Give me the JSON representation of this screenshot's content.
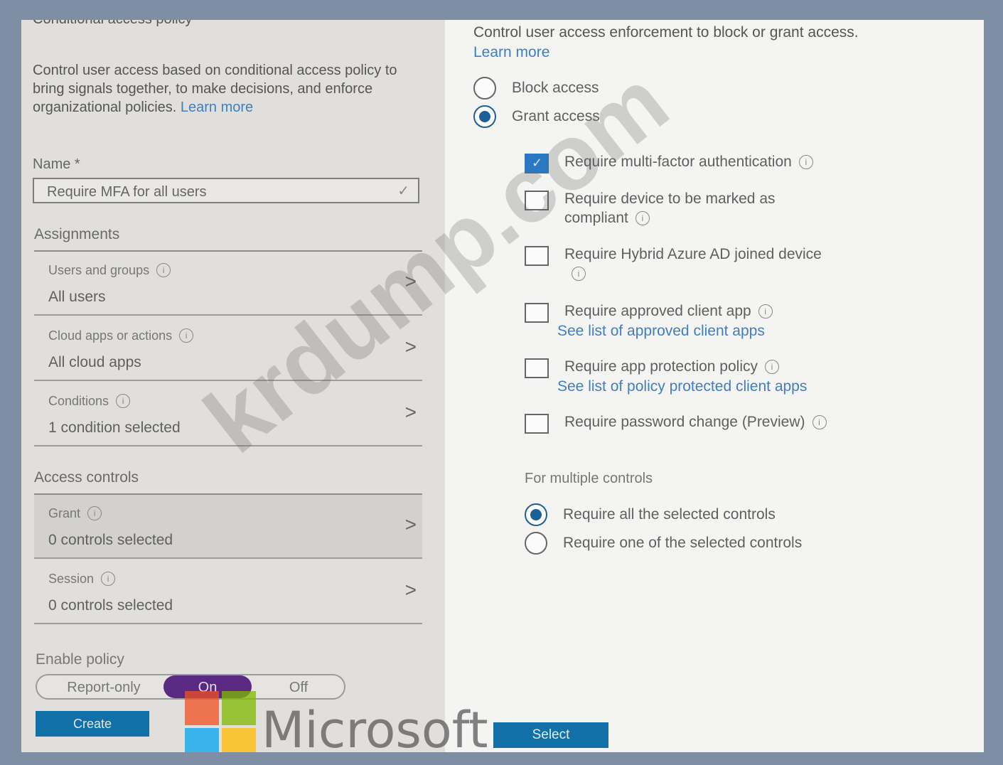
{
  "left": {
    "header_partial": "Conditional access policy",
    "intro": "Control user access based on conditional access policy to bring signals together, to make decisions, and enforce organizational policies.",
    "intro_link": "Learn more",
    "name_label": "Name *",
    "name_value": "Require MFA for all users",
    "assignments_title": "Assignments",
    "assignments": [
      {
        "label": "Users and groups",
        "value": "All users"
      },
      {
        "label": "Cloud apps or actions",
        "value": "All cloud apps"
      },
      {
        "label": "Conditions",
        "value": "1 condition selected"
      }
    ],
    "access_controls_title": "Access controls",
    "access_controls": [
      {
        "label": "Grant",
        "value": "0 controls selected"
      },
      {
        "label": "Session",
        "value": "0 controls selected"
      }
    ],
    "enable_label": "Enable policy",
    "enable_options": [
      "Report-only",
      "On",
      "Off"
    ],
    "enable_selected": "On",
    "create_label": "Create"
  },
  "right": {
    "intro": "Control user access enforcement to block or grant access.",
    "intro_link": "Learn more",
    "access_options": [
      {
        "label": "Block access",
        "selected": false
      },
      {
        "label": "Grant access",
        "selected": true
      }
    ],
    "grant_controls": [
      {
        "label": "Require multi-factor authentication",
        "checked": true,
        "link": ""
      },
      {
        "label": "Require device to be marked as compliant",
        "checked": false,
        "link": ""
      },
      {
        "label": "Require Hybrid Azure AD joined device",
        "checked": false,
        "link": ""
      },
      {
        "label": "Require approved client app",
        "checked": false,
        "link": "See list of approved client apps"
      },
      {
        "label": "Require app protection policy",
        "checked": false,
        "link": "See list of policy protected client apps"
      },
      {
        "label": "Require password change (Preview)",
        "checked": false,
        "link": ""
      }
    ],
    "multiple_controls_label": "For multiple controls",
    "multiple_options": [
      {
        "label": "Require all the selected controls",
        "selected": true
      },
      {
        "label": "Require one of the selected controls",
        "selected": false
      }
    ],
    "select_label": "Select"
  },
  "watermark": {
    "text": "krdump.com",
    "brand": "Microsoft",
    "logo_colors": [
      "#f25022",
      "#7fba00",
      "#00a4ef",
      "#ffb900"
    ]
  }
}
